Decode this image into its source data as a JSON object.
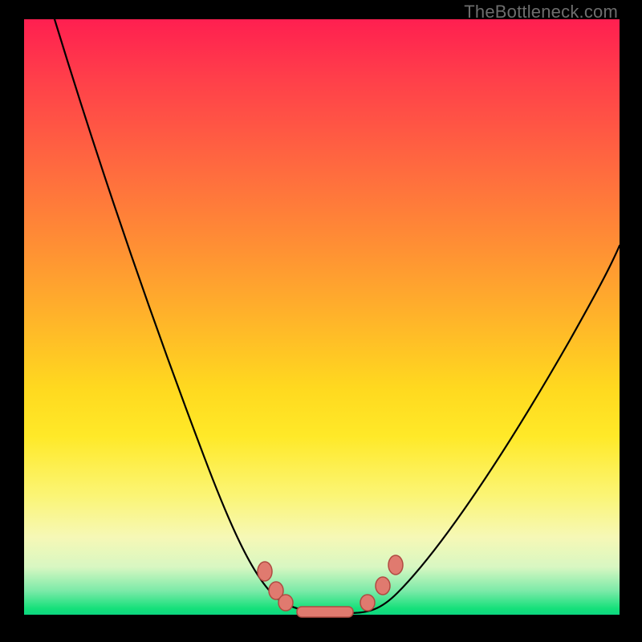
{
  "watermark": {
    "text": "TheBottleneck.com"
  },
  "colors": {
    "curve": "#000000",
    "marker_fill": "#e07a6f",
    "marker_stroke": "#b04a42",
    "gradient_top": "#ff1f50",
    "gradient_bottom": "#0cd680",
    "background": "#000000"
  },
  "chart_data": {
    "type": "line",
    "title": "",
    "xlabel": "",
    "ylabel": "",
    "xlim": [
      0,
      100
    ],
    "ylim": [
      0,
      100
    ],
    "grid": false,
    "legend": false,
    "x": [
      5,
      10,
      15,
      20,
      25,
      30,
      35,
      38,
      40,
      42,
      44,
      46,
      48,
      50,
      52,
      54,
      56,
      60,
      65,
      70,
      75,
      80,
      85,
      90,
      95,
      100
    ],
    "values": [
      100,
      88,
      76,
      63,
      50,
      37,
      24,
      16,
      11,
      7,
      4,
      2,
      1,
      1,
      1,
      1,
      1,
      3,
      8,
      15,
      23,
      31,
      40,
      49,
      58,
      65
    ],
    "markers": {
      "x": [
        38,
        40,
        42,
        47,
        51,
        55,
        57,
        59
      ],
      "y": [
        12,
        9,
        6,
        1,
        1,
        2,
        5,
        8
      ]
    },
    "annotations": [
      {
        "text": "TheBottleneck.com",
        "position": "top-right"
      }
    ]
  }
}
